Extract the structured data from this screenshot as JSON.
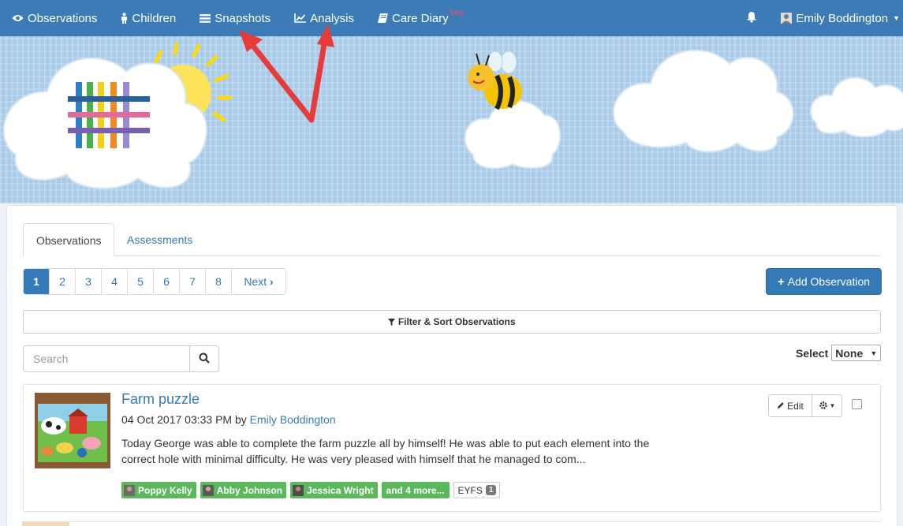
{
  "navbar": {
    "items": [
      {
        "label": "Observations",
        "icon": "eye-icon"
      },
      {
        "label": "Children",
        "icon": "child-icon"
      },
      {
        "label": "Snapshots",
        "icon": "list-icon"
      },
      {
        "label": "Analysis",
        "icon": "line-chart-icon"
      },
      {
        "label": "Care Diary",
        "icon": "book-icon",
        "badge": "beta"
      }
    ],
    "user": "Emily Boddington",
    "color": "#3b7cb7"
  },
  "tabs": [
    "Observations",
    "Assessments"
  ],
  "pagination": {
    "pages": [
      "1",
      "2",
      "3",
      "4",
      "5",
      "6",
      "7",
      "8"
    ],
    "next": "Next",
    "active": "1"
  },
  "add_button": "Add Observation",
  "filter_label": "Filter & Sort Observations",
  "search": {
    "placeholder": "Search",
    "value": ""
  },
  "select": {
    "label": "Select",
    "value": "None"
  },
  "observation": {
    "title": "Farm puzzle",
    "date": "04 Oct 2017 03:33 PM",
    "by": "by",
    "author": "Emily Boddington",
    "text": "Today George was able to complete the farm puzzle all by himself! He was able to put each element into the correct hole with minimal difficulty. He was very pleased with himself that he managed to com...",
    "children": [
      "Poppy Kelly",
      "Abby Johnson",
      "Jessica Wright"
    ],
    "more": "and 4 more...",
    "framework": "EYFS",
    "framework_count": "1",
    "edit_label": "Edit"
  },
  "colors": {
    "primary": "#337ab7",
    "success": "#5cb85c",
    "annotation_arrow": "#e63b3b"
  }
}
